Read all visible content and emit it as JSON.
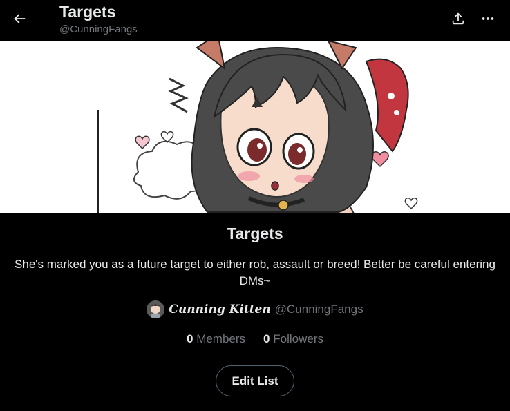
{
  "header": {
    "title": "Targets",
    "handle": "@CunningFangs"
  },
  "list": {
    "name": "Targets",
    "description": "She's marked you as a future target to either rob, assault or breed! Better be careful entering DMs~",
    "owner_name": "Cunning Kitten",
    "owner_handle": "@CunningFangs",
    "members_count": "0",
    "members_label": "Members",
    "followers_count": "0",
    "followers_label": "Followers",
    "edit_label": "Edit List"
  },
  "icons": {
    "back": "arrow-left-icon",
    "share": "share-upload-icon",
    "more": "more-horizontal-icon"
  },
  "colors": {
    "background": "#000000",
    "text_primary": "#e7e9ea",
    "text_secondary": "#71767b",
    "button_border": "#536471"
  }
}
